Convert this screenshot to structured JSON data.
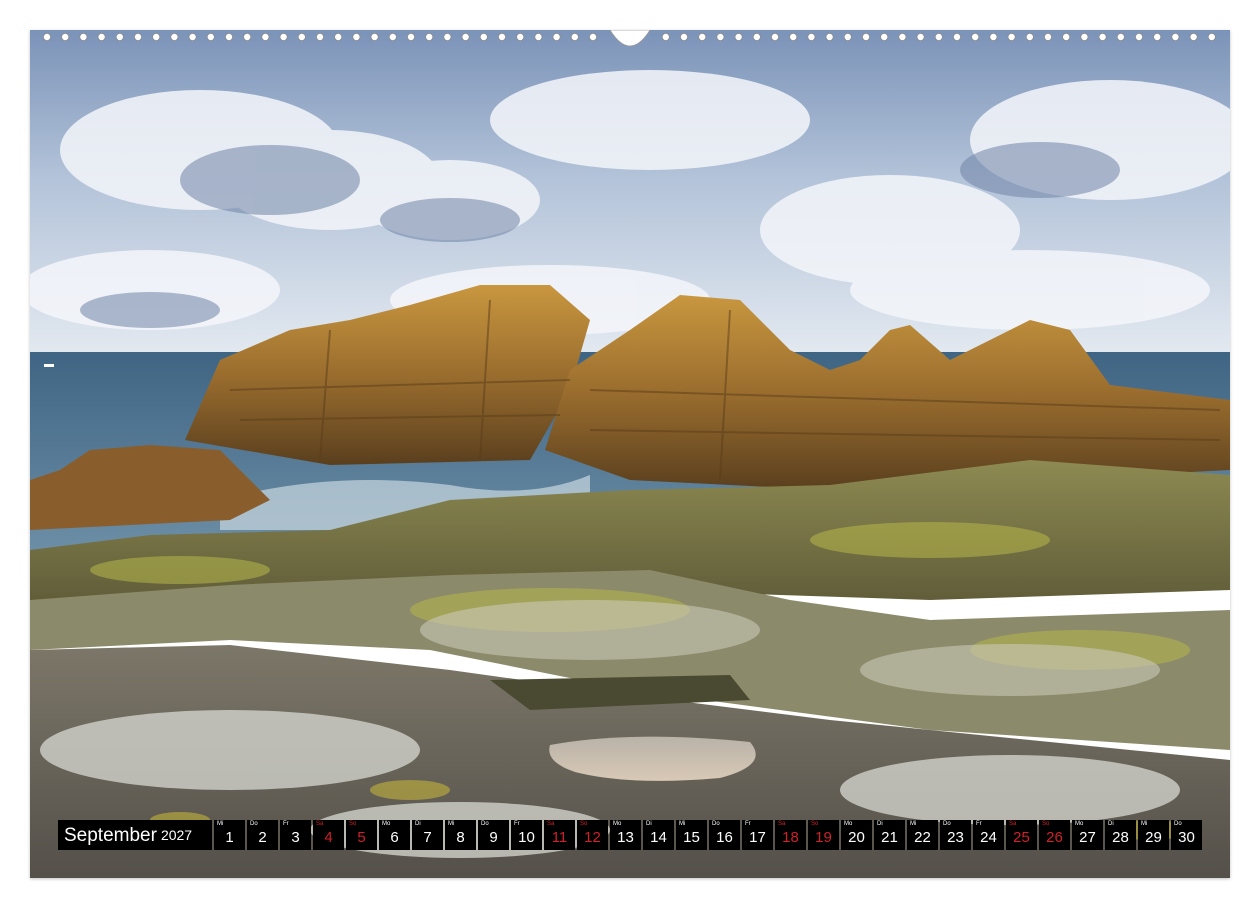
{
  "photo": {
    "subject": "rocky coastline with granite boulders, lichen-covered rocks, tide pool, sea and cloudy sky"
  },
  "binding": {
    "hole_style": "small white circles"
  },
  "calendar": {
    "month_label": "September",
    "year_label": "2027",
    "weekend_color": "#d0202a",
    "cell_color": "#000000",
    "days": [
      {
        "wd": "Mi",
        "num": "1",
        "weekend": false
      },
      {
        "wd": "Do",
        "num": "2",
        "weekend": false
      },
      {
        "wd": "Fr",
        "num": "3",
        "weekend": false
      },
      {
        "wd": "Sa",
        "num": "4",
        "weekend": true
      },
      {
        "wd": "So",
        "num": "5",
        "weekend": true
      },
      {
        "wd": "Mo",
        "num": "6",
        "weekend": false
      },
      {
        "wd": "Di",
        "num": "7",
        "weekend": false
      },
      {
        "wd": "Mi",
        "num": "8",
        "weekend": false
      },
      {
        "wd": "Do",
        "num": "9",
        "weekend": false
      },
      {
        "wd": "Fr",
        "num": "10",
        "weekend": false
      },
      {
        "wd": "Sa",
        "num": "11",
        "weekend": true
      },
      {
        "wd": "So",
        "num": "12",
        "weekend": true
      },
      {
        "wd": "Mo",
        "num": "13",
        "weekend": false
      },
      {
        "wd": "Di",
        "num": "14",
        "weekend": false
      },
      {
        "wd": "Mi",
        "num": "15",
        "weekend": false
      },
      {
        "wd": "Do",
        "num": "16",
        "weekend": false
      },
      {
        "wd": "Fr",
        "num": "17",
        "weekend": false
      },
      {
        "wd": "Sa",
        "num": "18",
        "weekend": true
      },
      {
        "wd": "So",
        "num": "19",
        "weekend": true
      },
      {
        "wd": "Mo",
        "num": "20",
        "weekend": false
      },
      {
        "wd": "Di",
        "num": "21",
        "weekend": false
      },
      {
        "wd": "Mi",
        "num": "22",
        "weekend": false
      },
      {
        "wd": "Do",
        "num": "23",
        "weekend": false
      },
      {
        "wd": "Fr",
        "num": "24",
        "weekend": false
      },
      {
        "wd": "Sa",
        "num": "25",
        "weekend": true
      },
      {
        "wd": "So",
        "num": "26",
        "weekend": true
      },
      {
        "wd": "Mo",
        "num": "27",
        "weekend": false
      },
      {
        "wd": "Di",
        "num": "28",
        "weekend": false
      },
      {
        "wd": "Mi",
        "num": "29",
        "weekend": false
      },
      {
        "wd": "Do",
        "num": "30",
        "weekend": false
      }
    ]
  }
}
